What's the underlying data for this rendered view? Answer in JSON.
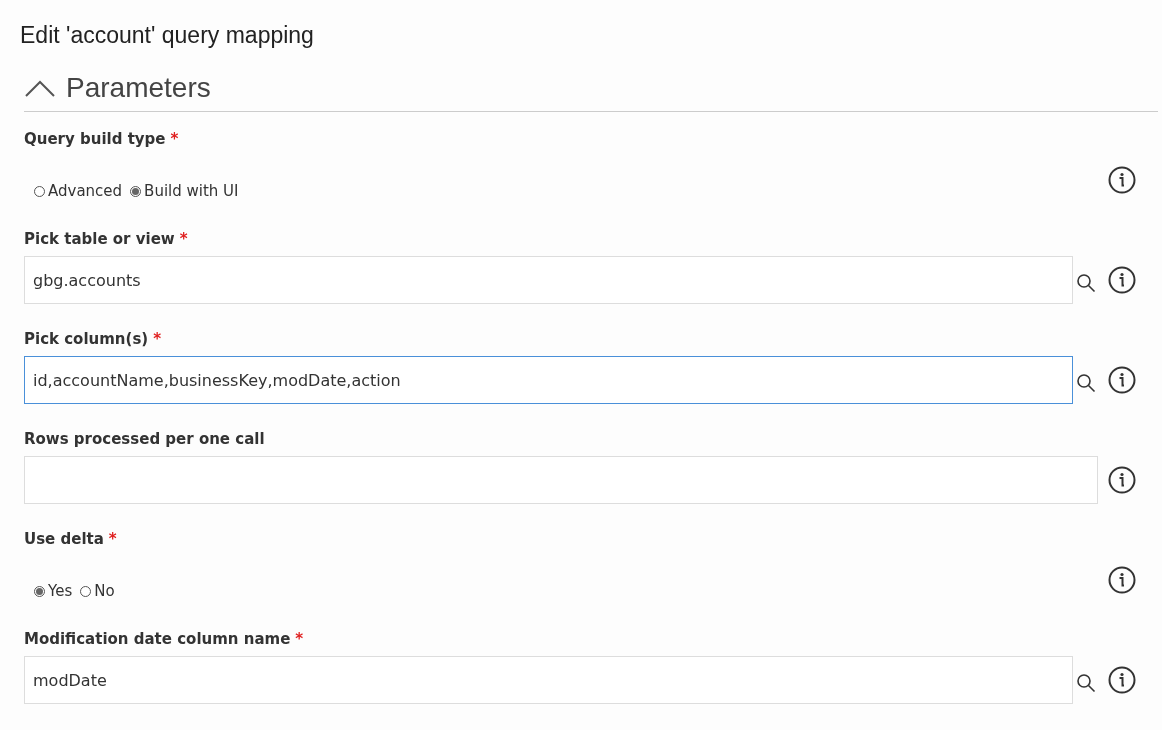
{
  "dialog": {
    "title": "Edit 'account' query mapping"
  },
  "section": {
    "title": "Parameters",
    "expanded": true
  },
  "fields": [
    {
      "kind": "radio",
      "label": "Query build type",
      "required_mark": "*",
      "options": [
        {
          "label": "Advanced",
          "selected": false
        },
        {
          "label": "Build with UI",
          "selected": true
        }
      ]
    },
    {
      "kind": "lookup",
      "label": "Pick table or view",
      "required_mark": "*",
      "value": "gbg.accounts",
      "focused": false
    },
    {
      "kind": "lookup",
      "label": "Pick column(s)",
      "required_mark": "*",
      "value": "id,accountName,businessKey,modDate,action",
      "focused": true
    },
    {
      "kind": "text",
      "label": "Rows processed per one call",
      "focused": false
    },
    {
      "kind": "radio",
      "label": "Use delta",
      "required_mark": "*",
      "options": [
        {
          "label": "Yes",
          "selected": true
        },
        {
          "label": "No",
          "selected": false
        }
      ]
    },
    {
      "kind": "lookup",
      "label": "Modification date column name",
      "required_mark": "*",
      "value": "modDate",
      "focused": false
    }
  ]
}
